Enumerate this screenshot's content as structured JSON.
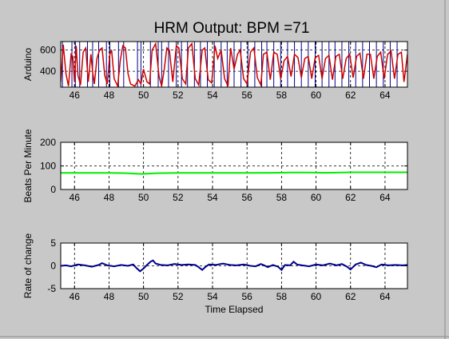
{
  "window": {
    "background": "#c8c8c8"
  },
  "title": "HRM Output: BPM =71",
  "chart_data": [
    {
      "type": "line",
      "ylabel": "Arduino",
      "xlabel": "",
      "xlim": [
        45.2,
        65.3
      ],
      "ylim": [
        250,
        680
      ],
      "xticks": [
        "46",
        "48",
        "50",
        "52",
        "54",
        "56",
        "58",
        "60",
        "62",
        "64"
      ],
      "yticks": [
        "400",
        "600"
      ],
      "grid": true,
      "colors": {
        "signal": "#cc0000",
        "beat_markers": "#00008b"
      },
      "beat_times": [
        45.3,
        45.85,
        46.05,
        46.3,
        46.75,
        47.05,
        47.4,
        47.85,
        48.05,
        48.55,
        48.85,
        49.65,
        49.85,
        50.4,
        50.85,
        51.05,
        51.45,
        51.9,
        52.2,
        52.55,
        52.95,
        53.3,
        53.7,
        54.1,
        54.5,
        54.85,
        55.25,
        55.65,
        56.05,
        56.45,
        56.85,
        57.15,
        57.55,
        57.95,
        58.35,
        58.75,
        59.15,
        59.55,
        59.95,
        60.35,
        60.75,
        61.1,
        61.5,
        61.9,
        62.3,
        62.7,
        63.1,
        63.5,
        63.9,
        64.3,
        64.7
      ],
      "signal": {
        "x": [
          45.2,
          45.35,
          45.5,
          45.65,
          45.8,
          45.9,
          46.0,
          46.1,
          46.2,
          46.35,
          46.5,
          46.65,
          46.8,
          46.95,
          47.05,
          47.15,
          47.3,
          47.45,
          47.6,
          47.75,
          47.9,
          48.05,
          48.15,
          48.3,
          48.5,
          48.65,
          48.8,
          48.95,
          49.1,
          49.25,
          49.5,
          49.7,
          49.85,
          50.0,
          50.2,
          50.35,
          50.5,
          50.7,
          50.9,
          51.05,
          51.2,
          51.35,
          51.5,
          51.7,
          51.9,
          52.05,
          52.25,
          52.45,
          52.6,
          52.8,
          53.0,
          53.2,
          53.4,
          53.55,
          53.75,
          53.95,
          54.15,
          54.3,
          54.5,
          54.7,
          54.9,
          55.05,
          55.25,
          55.45,
          55.6,
          55.8,
          56.0,
          56.2,
          56.4,
          56.6,
          56.8,
          56.95,
          57.15,
          57.35,
          57.55,
          57.75,
          57.95,
          58.15,
          58.35,
          58.55,
          58.75,
          58.95,
          59.15,
          59.35,
          59.55,
          59.75,
          59.95,
          60.15,
          60.35,
          60.55,
          60.75,
          60.95,
          61.15,
          61.35,
          61.55,
          61.75,
          61.95,
          62.15,
          62.35,
          62.55,
          62.75,
          62.95,
          63.15,
          63.35,
          63.55,
          63.75,
          63.95,
          64.15,
          64.35,
          64.55,
          64.75,
          64.95,
          65.1,
          65.3
        ],
        "y": [
          300,
          650,
          380,
          260,
          560,
          540,
          300,
          640,
          360,
          270,
          580,
          620,
          300,
          560,
          400,
          280,
          520,
          600,
          620,
          360,
          280,
          560,
          600,
          330,
          260,
          500,
          640,
          620,
          380,
          280,
          260,
          320,
          280,
          420,
          300,
          280,
          600,
          660,
          350,
          260,
          420,
          620,
          600,
          300,
          640,
          620,
          330,
          280,
          620,
          660,
          330,
          270,
          600,
          620,
          320,
          290,
          640,
          520,
          600,
          330,
          260,
          620,
          420,
          560,
          600,
          330,
          280,
          580,
          620,
          340,
          270,
          560,
          580,
          320,
          580,
          560,
          330,
          500,
          540,
          350,
          560,
          530,
          340,
          520,
          540,
          330,
          530,
          550,
          330,
          520,
          550,
          320,
          540,
          560,
          330,
          520,
          560,
          340,
          540,
          570,
          330,
          560,
          560,
          330,
          540,
          580,
          330,
          560,
          590,
          330,
          560,
          580,
          300,
          560,
          580
        ]
      }
    },
    {
      "type": "line",
      "ylabel": "Beats Per Minute",
      "xlabel": "",
      "xlim": [
        45.2,
        65.3
      ],
      "ylim": [
        0,
        200
      ],
      "xticks": [
        "46",
        "48",
        "50",
        "52",
        "54",
        "56",
        "58",
        "60",
        "62",
        "64"
      ],
      "yticks": [
        "0",
        "100",
        "200"
      ],
      "grid": true,
      "colors": {
        "line": "#00ee00"
      },
      "series": [
        {
          "x": [
            45.2,
            46,
            47,
            48,
            49,
            49.8,
            50.2,
            50.8,
            52,
            54,
            56,
            57.5,
            58.5,
            59.5,
            60.5,
            61.5,
            62,
            63,
            64,
            65.3
          ],
          "values": [
            70,
            70,
            70,
            70,
            69,
            66,
            67,
            69,
            70,
            70,
            70,
            71,
            72,
            72,
            71,
            72,
            73,
            73,
            73,
            73
          ]
        }
      ]
    },
    {
      "type": "line",
      "ylabel": "Rate of change",
      "xlabel": "Time Elapsed",
      "xlim": [
        45.2,
        65.3
      ],
      "ylim": [
        -5,
        5
      ],
      "xticks": [
        "46",
        "48",
        "50",
        "52",
        "54",
        "56",
        "58",
        "60",
        "62",
        "64"
      ],
      "yticks": [
        "-5",
        "0",
        "5"
      ],
      "grid": true,
      "colors": {
        "line": "#00008b"
      },
      "series": [
        {
          "x": [
            45.2,
            45.5,
            45.8,
            46.2,
            46.6,
            47.0,
            47.4,
            47.6,
            47.9,
            48.3,
            48.7,
            49.1,
            49.4,
            49.6,
            49.8,
            50.0,
            50.2,
            50.4,
            50.55,
            50.7,
            51.0,
            51.4,
            51.8,
            52.2,
            52.6,
            53.0,
            53.2,
            53.4,
            53.6,
            53.8,
            54.2,
            54.6,
            55.0,
            55.4,
            55.8,
            56.2,
            56.5,
            56.8,
            57.0,
            57.2,
            57.5,
            57.8,
            58.0,
            58.2,
            58.5,
            58.7,
            58.9,
            59.2,
            59.6,
            60.0,
            60.4,
            60.8,
            61.2,
            61.5,
            61.8,
            62.0,
            62.3,
            62.6,
            62.9,
            63.2,
            63.5,
            63.8,
            64.2,
            64.6,
            65.0,
            65.3
          ],
          "values": [
            0,
            0.1,
            -0.1,
            0.3,
            0.1,
            -0.2,
            0.2,
            0.6,
            0.1,
            -0.1,
            0.2,
            0,
            0.3,
            -0.5,
            -1.2,
            -0.6,
            0.2,
            0.9,
            1.2,
            0.5,
            0.2,
            0.1,
            0.4,
            0.2,
            0.3,
            0.2,
            -0.3,
            -0.9,
            -0.2,
            0.3,
            0.2,
            0.5,
            0.2,
            0.1,
            0.3,
            0,
            -0.1,
            0.4,
            0.1,
            -0.3,
            0.2,
            -0.2,
            -0.9,
            0.2,
            0.1,
            0.9,
            0.3,
            0.1,
            -0.1,
            0.3,
            0.1,
            0.5,
            0.1,
            0.4,
            -0.2,
            -0.8,
            0.3,
            0.7,
            0.2,
            0,
            -0.3,
            0.3,
            0.1,
            0.2,
            0.1,
            0.2
          ]
        }
      ]
    }
  ]
}
